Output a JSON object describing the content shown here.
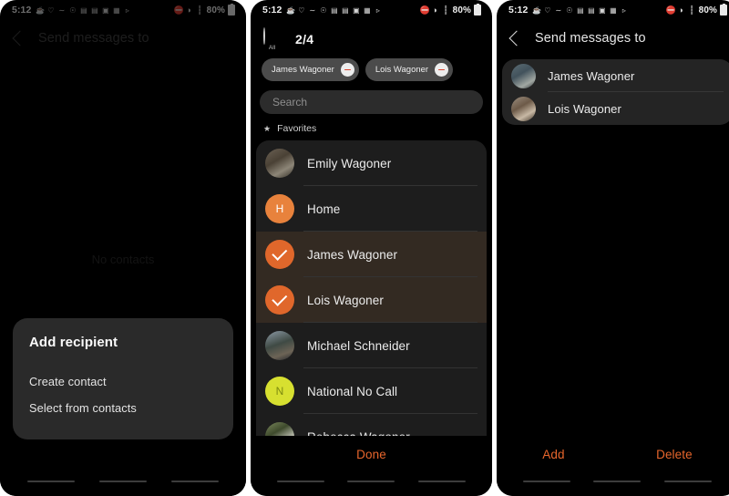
{
  "status_bar": {
    "clock": "5:12",
    "left_icons": [
      "coffee-icon",
      "heart-icon",
      "sleep-icon",
      "mute-notification-icon",
      "car-icon",
      "car-icon-2",
      "image-icon",
      "app-icon",
      "play-icon"
    ],
    "right_icons": [
      "volume-mute-icon",
      "wifi-icon",
      "signal-icon"
    ],
    "battery_text": "80%"
  },
  "panel1": {
    "title": "Send messages to",
    "back_icon": "back-chevron-icon",
    "empty_text": "No contacts",
    "dialog": {
      "title": "Add recipient",
      "items": [
        {
          "label": "Create contact"
        },
        {
          "label": "Select from contacts"
        }
      ]
    }
  },
  "panel2": {
    "all_checkbox_label": "All",
    "selection_count": "2/4",
    "chips": [
      {
        "label": "James Wagoner",
        "remove_icon": "remove-circle-icon"
      },
      {
        "label": "Lois Wagoner",
        "remove_icon": "remove-circle-icon"
      }
    ],
    "search": {
      "placeholder": "Search",
      "value": ""
    },
    "section_header": {
      "icon": "star-icon",
      "label": "Favorites"
    },
    "contacts": [
      {
        "name": "Emily Wagoner",
        "avatar_type": "photo",
        "avatar_class": "photo-a",
        "initial": "",
        "selected": false
      },
      {
        "name": "Home",
        "avatar_type": "initial",
        "avatar_class": "initial-orange",
        "initial": "H",
        "selected": false
      },
      {
        "name": "James Wagoner",
        "avatar_type": "check",
        "avatar_class": "check",
        "initial": "",
        "selected": true
      },
      {
        "name": "Lois Wagoner",
        "avatar_type": "check",
        "avatar_class": "check",
        "initial": "",
        "selected": true
      },
      {
        "name": "Michael Schneider",
        "avatar_type": "photo",
        "avatar_class": "photo-b",
        "initial": "",
        "selected": false
      },
      {
        "name": "National No Call",
        "avatar_type": "initial",
        "avatar_class": "initial-yellow",
        "initial": "N",
        "selected": false
      },
      {
        "name": "Rebecca Wagoner",
        "avatar_type": "photo",
        "avatar_class": "photo-c",
        "initial": "",
        "selected": false
      }
    ],
    "done_label": "Done"
  },
  "panel3": {
    "title": "Send messages to",
    "back_icon": "back-chevron-icon",
    "recipients": [
      {
        "name": "James Wagoner",
        "avatar_class": "photo-e"
      },
      {
        "name": "Lois Wagoner",
        "avatar_class": "photo-d"
      }
    ],
    "add_label": "Add",
    "delete_label": "Delete"
  },
  "colors": {
    "accent_orange": "#e8662c",
    "selected_row": "#332a22",
    "panel_background": "#000000",
    "list_background": "#1d1d1d"
  }
}
